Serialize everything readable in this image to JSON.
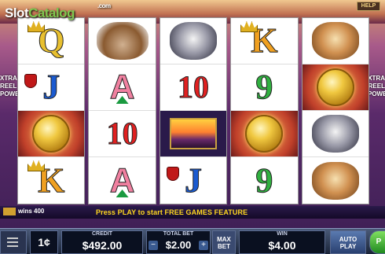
{
  "branding": {
    "logo_prefix": "Slot",
    "logo_suffix": "Catalog",
    "logo_tld": ".com"
  },
  "header": {
    "help_label": "HELP"
  },
  "side_panels": {
    "left_text": "XTRA REEL POWER",
    "right_text": "XTRA REEL POWER"
  },
  "reels": [
    [
      {
        "type": "letter",
        "text": "Q",
        "cls": "sym-Q",
        "ornament": "crown"
      },
      {
        "type": "letter",
        "text": "J",
        "cls": "sym-J",
        "ornament": "shield"
      },
      {
        "type": "coin"
      },
      {
        "type": "letter",
        "text": "K",
        "cls": "sym-K",
        "ornament": "crown"
      }
    ],
    [
      {
        "type": "animal",
        "animal": "elk"
      },
      {
        "type": "letter",
        "text": "A",
        "cls": "sym-A",
        "ornament": "gem"
      },
      {
        "type": "letter",
        "text": "10",
        "cls": "sym-10"
      },
      {
        "type": "letter",
        "text": "A",
        "cls": "sym-A",
        "ornament": "gem"
      }
    ],
    [
      {
        "type": "animal",
        "animal": "wolf"
      },
      {
        "type": "letter",
        "text": "10",
        "cls": "sym-10"
      },
      {
        "type": "sunset"
      },
      {
        "type": "letter",
        "text": "J",
        "cls": "sym-J",
        "ornament": "shield"
      }
    ],
    [
      {
        "type": "letter",
        "text": "K",
        "cls": "sym-K",
        "ornament": "crown"
      },
      {
        "type": "letter",
        "text": "9",
        "cls": "sym-9"
      },
      {
        "type": "coin"
      },
      {
        "type": "letter",
        "text": "9",
        "cls": "sym-9"
      }
    ],
    [
      {
        "type": "animal",
        "animal": "cougar"
      },
      {
        "type": "coin"
      },
      {
        "type": "animal",
        "animal": "wolf"
      },
      {
        "type": "animal",
        "animal": "cougar"
      }
    ]
  ],
  "message_bar": {
    "wins_text": "wins 400",
    "feature_text": "Press PLAY to start FREE GAMES FEATURE"
  },
  "controls": {
    "denomination": "1¢",
    "credit_label": "CREDIT",
    "credit_value": "$492.00",
    "total_bet_label": "TOTAL BET",
    "total_bet_value": "$2.00",
    "minus_label": "−",
    "plus_label": "+",
    "max_bet_label": "MAX BET",
    "win_label": "WIN",
    "win_value": "$4.00",
    "autoplay_label": "AUTO PLAY",
    "play_label": "P"
  }
}
